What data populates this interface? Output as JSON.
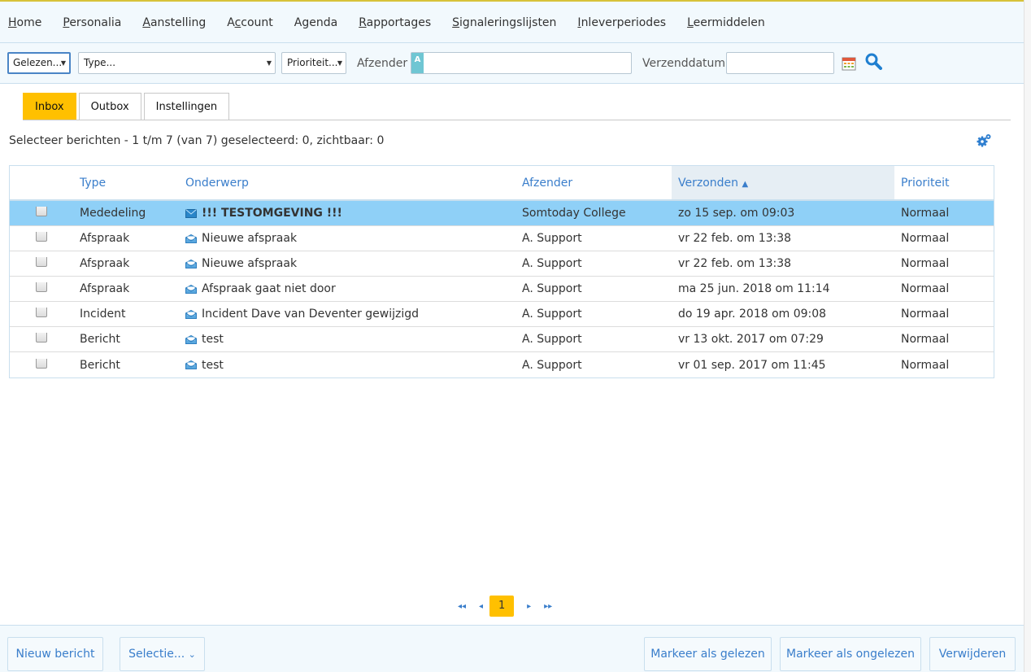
{
  "nav": [
    {
      "label": "Home",
      "key": "H"
    },
    {
      "label": "Personalia",
      "key": "P"
    },
    {
      "label": "Aanstelling",
      "key": "A"
    },
    {
      "label": "Account",
      "key": "c"
    },
    {
      "label": "Agenda",
      "key": ""
    },
    {
      "label": "Rapportages",
      "key": "R"
    },
    {
      "label": "Signaleringslijsten",
      "key": "S"
    },
    {
      "label": "Inleverperiodes",
      "key": "I"
    },
    {
      "label": "Leermiddelen",
      "key": "L"
    }
  ],
  "filters": {
    "read_select": "Gelezen...",
    "type_select": "Type...",
    "priority_select": "Prioriteit...",
    "sender_label": "Afzender",
    "sender_badge": "A",
    "sender_value": "",
    "date_label": "Verzenddatum",
    "date_value": ""
  },
  "tabs": [
    {
      "label": "Inbox",
      "active": true
    },
    {
      "label": "Outbox",
      "active": false
    },
    {
      "label": "Instellingen",
      "active": false
    }
  ],
  "selection_info": "Selecteer berichten - 1 t/m 7 (van 7) geselecteerd: 0, zichtbaar: 0",
  "table": {
    "headers": {
      "type": "Type",
      "subject": "Onderwerp",
      "sender": "Afzender",
      "sent": "Verzonden",
      "priority": "Prioriteit"
    },
    "sort_indicator": "▲",
    "rows": [
      {
        "type": "Mededeling",
        "subject": "!!! TESTOMGEVING !!!",
        "sender": "Somtoday College",
        "sent": "zo 15 sep. om 09:03",
        "priority": "Normaal",
        "selected": true,
        "bold": true
      },
      {
        "type": "Afspraak",
        "subject": "Nieuwe afspraak",
        "sender": "A. Support",
        "sent": "vr 22 feb. om 13:38",
        "priority": "Normaal"
      },
      {
        "type": "Afspraak",
        "subject": "Nieuwe afspraak",
        "sender": "A. Support",
        "sent": "vr 22 feb. om 13:38",
        "priority": "Normaal"
      },
      {
        "type": "Afspraak",
        "subject": "Afspraak gaat niet door",
        "sender": "A. Support",
        "sent": "ma 25 jun. 2018 om 11:14",
        "priority": "Normaal"
      },
      {
        "type": "Incident",
        "subject": "Incident Dave van Deventer gewijzigd",
        "sender": "A. Support",
        "sent": "do 19 apr. 2018 om 09:08",
        "priority": "Normaal"
      },
      {
        "type": "Bericht",
        "subject": "test",
        "sender": "A. Support",
        "sent": "vr 13 okt. 2017 om 07:29",
        "priority": "Normaal"
      },
      {
        "type": "Bericht",
        "subject": "test",
        "sender": "A. Support",
        "sent": "vr 01 sep. 2017 om 11:45",
        "priority": "Normaal"
      }
    ]
  },
  "pager": {
    "first": "◂◂",
    "prev": "◂",
    "current": "1",
    "next": "▸",
    "last": "▸▸"
  },
  "footer": {
    "new_message": "Nieuw bericht",
    "selection": "Selectie...",
    "mark_read": "Markeer als gelezen",
    "mark_unread": "Markeer als ongelezen",
    "delete": "Verwijderen"
  },
  "colors": {
    "accent": "#ffc000",
    "link": "#3a7ecb",
    "selected_row": "#8fd0f7",
    "bar_bg": "#f2f9fd"
  }
}
